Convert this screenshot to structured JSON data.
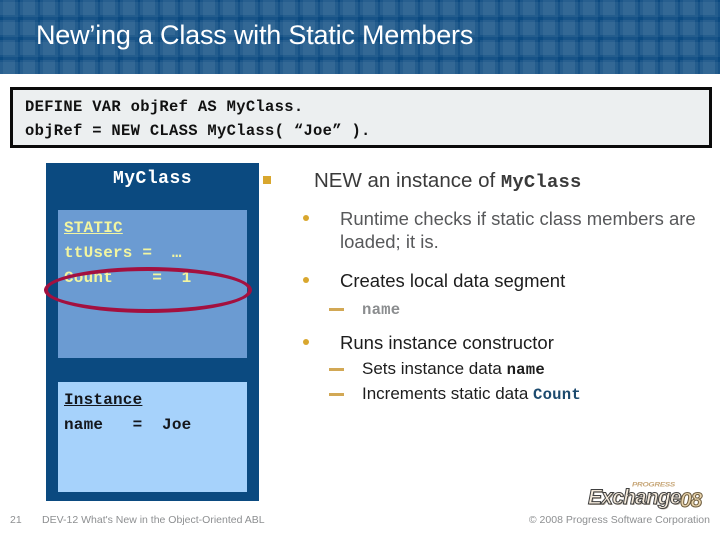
{
  "slide": {
    "title": "New’ing a Class with Static Members",
    "page_number": "21",
    "footer_text": "DEV-12 What's New in the Object-Oriented ABL",
    "copyright": "© 2008 Progress Software Corporation"
  },
  "code_block": {
    "line1": "DEFINE VAR objRef AS MyClass.",
    "line2": "objRef = NEW CLASS MyClass( “Joe” )."
  },
  "diagram": {
    "class_name": "MyClass",
    "static_section": {
      "heading": "STATIC",
      "lines": [
        "ttUsers =  …",
        "Count    =  1"
      ]
    },
    "instance_section": {
      "heading": "Instance",
      "lines": [
        "name   =  Joe"
      ]
    },
    "highlight_target": "Count    =  1"
  },
  "bullets": {
    "level1": {
      "text_before": "NEW an instance of ",
      "code": "MyClass"
    },
    "item_runtime": "Runtime checks if static class members are loaded; it is.",
    "item_creates": "Creates local data segment",
    "item_creates_sub": "name",
    "item_runs": "Runs instance constructor",
    "item_runs_sub1_before": "Sets instance data ",
    "item_runs_sub1_code": "name",
    "item_runs_sub2_before": "Increments static data ",
    "item_runs_sub2_code": "Count"
  },
  "logo": {
    "progress": "PROGRESS",
    "exchange": "Exchange",
    "year": "08"
  },
  "colors": {
    "banner_blue": "#0b4a80",
    "accent_gold": "#d9a72e",
    "highlight_red": "#a3103f",
    "static_panel": "#6b9bd2",
    "instance_panel": "#a6d2fb",
    "static_text": "#f2f5a0"
  }
}
